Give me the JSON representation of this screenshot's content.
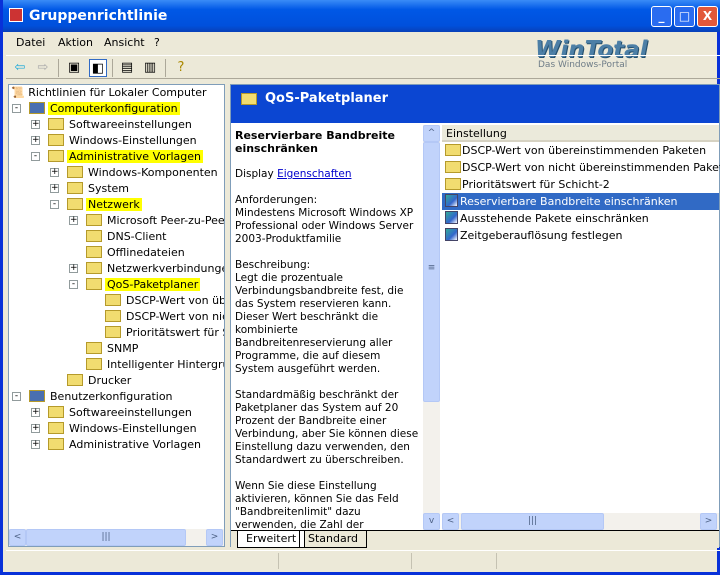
{
  "window": {
    "title": "Gruppenrichtlinie",
    "minimize": "_",
    "maximize": "□",
    "close": "X"
  },
  "menu": [
    "Datei",
    "Aktion",
    "Ansicht",
    "?"
  ],
  "logo": {
    "name": "WinTotal",
    "tagline": "Das Windows-Portal"
  },
  "toolbar": [
    "back-icon",
    "forward-icon",
    "up-folder-icon",
    "show-hide-tree-icon",
    "properties-icon",
    "export-list-icon",
    "help-icon"
  ],
  "tree": {
    "root": "Richtlinien für Lokaler Computer",
    "items": [
      {
        "label": "Computerkonfiguration",
        "level": 0,
        "expander": "-",
        "highlight": true
      },
      {
        "label": "Softwareeinstellungen",
        "level": 1,
        "expander": "+"
      },
      {
        "label": "Windows-Einstellungen",
        "level": 1,
        "expander": "+"
      },
      {
        "label": "Administrative Vorlagen",
        "level": 1,
        "expander": "-",
        "highlight": true
      },
      {
        "label": "Windows-Komponenten",
        "level": 2,
        "expander": "+"
      },
      {
        "label": "System",
        "level": 2,
        "expander": "+"
      },
      {
        "label": "Netzwerk",
        "level": 2,
        "expander": "-",
        "highlight": true
      },
      {
        "label": "Microsoft Peer-zu-Peer-N",
        "level": 3,
        "expander": "+"
      },
      {
        "label": "DNS-Client",
        "level": 3,
        "expander": ""
      },
      {
        "label": "Offlinedateien",
        "level": 3,
        "expander": ""
      },
      {
        "label": "Netzwerkverbindungen",
        "level": 3,
        "expander": "+"
      },
      {
        "label": "QoS-Paketplaner",
        "level": 3,
        "expander": "-",
        "highlight": true
      },
      {
        "label": "DSCP-Wert von über",
        "level": 4,
        "expander": ""
      },
      {
        "label": "DSCP-Wert von nicht",
        "level": 4,
        "expander": ""
      },
      {
        "label": "Prioritätswert für Sch",
        "level": 4,
        "expander": ""
      },
      {
        "label": "SNMP",
        "level": 3,
        "expander": ""
      },
      {
        "label": "Intelligenter Hintergrund",
        "level": 3,
        "expander": ""
      },
      {
        "label": "Drucker",
        "level": 2,
        "expander": ""
      },
      {
        "label": "Benutzerkonfiguration",
        "level": 0,
        "expander": "-"
      },
      {
        "label": "Softwareeinstellungen",
        "level": 1,
        "expander": "+"
      },
      {
        "label": "Windows-Einstellungen",
        "level": 1,
        "expander": "+"
      },
      {
        "label": "Administrative Vorlagen",
        "level": 1,
        "expander": "+"
      }
    ]
  },
  "details": {
    "header": "QoS-Paketplaner",
    "heading": "Reservierbare Bandbreite einschränken",
    "display_label": "Display",
    "display_link": "Eigenschaften",
    "requirements": "Anforderungen:\nMindestens Microsoft Windows XP Professional oder Windows Server 2003-Produktfamilie",
    "description": "Beschreibung:\nLegt die prozentuale Verbindungsbandbreite fest, die das System reservieren kann. Dieser Wert beschränkt die kombinierte Bandbreitenreservierung aller Programme, die auf diesem System ausgeführt werden.",
    "para2": "Standardmäßig beschränkt der Paketplaner das System auf 20 Prozent der Bandbreite einer Verbindung, aber Sie können diese Einstellung dazu verwenden, den Standardwert zu überschreiben.",
    "para3": "Wenn Sie diese Einstellung aktivieren, können Sie das Feld \"Bandbreitenlimit\" dazu verwenden, die Zahl der Bandbreite die das System reservieren kann"
  },
  "list": {
    "column": "Einstellung",
    "items": [
      {
        "label": "DSCP-Wert von übereinstimmenden Paketen",
        "type": "folder"
      },
      {
        "label": "DSCP-Wert von nicht übereinstimmenden Paketen",
        "type": "folder"
      },
      {
        "label": "Prioritätswert für Schicht-2",
        "type": "folder"
      },
      {
        "label": "Reservierbare Bandbreite einschränken",
        "type": "policy",
        "selected": true
      },
      {
        "label": "Ausstehende Pakete einschränken",
        "type": "policy"
      },
      {
        "label": "Zeitgeberauflösung festlegen",
        "type": "policy"
      }
    ]
  },
  "tabs": [
    {
      "label": "Erweitert",
      "active": true
    },
    {
      "label": "Standard",
      "active": false
    }
  ]
}
